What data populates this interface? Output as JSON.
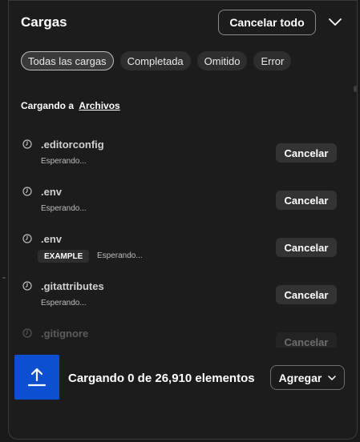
{
  "header": {
    "title": "Cargas",
    "cancel_all_label": "Cancelar todo",
    "collapse_icon": "chevron-down-icon"
  },
  "filters": [
    {
      "label": "Todas las cargas",
      "active": true
    },
    {
      "label": "Completada",
      "active": false
    },
    {
      "label": "Omitido",
      "active": false
    },
    {
      "label": "Error",
      "active": false
    }
  ],
  "destination": {
    "prefix": "Cargando a",
    "folder": "Archivos"
  },
  "uploads": [
    {
      "name": ".editorconfig",
      "status": "Esperando...",
      "tag": "",
      "action": "Cancelar"
    },
    {
      "name": ".env",
      "status": "Esperando...",
      "tag": "",
      "action": "Cancelar"
    },
    {
      "name": ".env",
      "status": "Esperando...",
      "tag": "EXAMPLE",
      "action": "Cancelar"
    },
    {
      "name": ".gitattributes",
      "status": "Esperando...",
      "tag": "",
      "action": "Cancelar"
    },
    {
      "name": ".gitignore",
      "status": "",
      "tag": "",
      "action": "Cancelar"
    }
  ],
  "footer": {
    "progress_text": "Cargando 0 de 26,910 elementos",
    "add_label": "Agregar",
    "upload_icon": "upload-arrow-icon"
  },
  "colors": {
    "background": "#1c1c1c",
    "upload_box": "#0d4fd1",
    "button": "#333333"
  }
}
